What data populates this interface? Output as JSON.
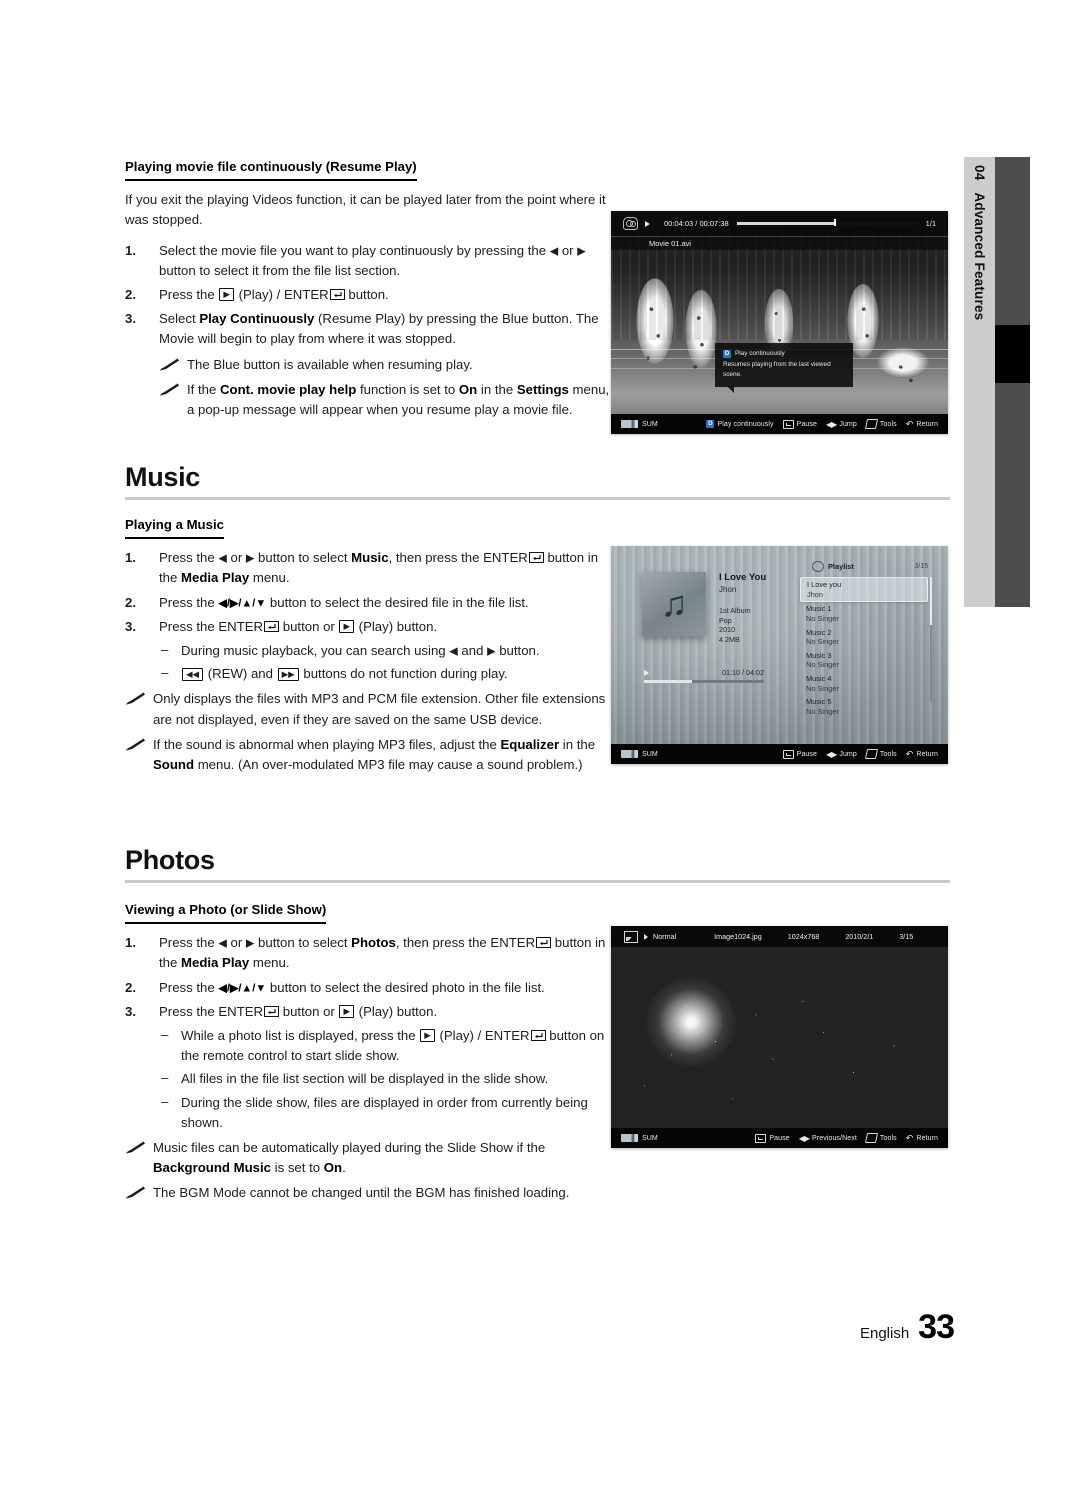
{
  "chapter_tab": {
    "number": "04",
    "label": "Advanced Features"
  },
  "footer": {
    "language": "English",
    "page": "33"
  },
  "resume_play": {
    "heading": "Playing movie file continuously (Resume Play)",
    "lead": "If you exit the playing Videos function, it can be played later from the point where it was stopped.",
    "steps": [
      {
        "num": "1.",
        "parts": [
          "Select the movie file you want to play continuously by pressing the ",
          "◀",
          " or ",
          "▶",
          " button to select it from the file list section."
        ]
      },
      {
        "num": "2.",
        "text_a": "Press the ",
        "key_play": "▶",
        "text_b": " (Play) / ",
        "text_enter": "ENTER",
        "text_c": " button."
      },
      {
        "num": "3.",
        "text_a": "Select ",
        "bold_a": "Play Continuously",
        "text_b": " (Resume Play) by pressing the Blue button. The Movie will begin to play from where it was stopped."
      }
    ],
    "notes": [
      {
        "text": "The Blue button is available when resuming play."
      },
      {
        "text_a": "If the ",
        "bold_a": "Cont. movie play help",
        "text_b": " function is set to ",
        "bold_b": "On",
        "text_c": " in the ",
        "bold_c": "Settings",
        "text_d": " menu, a pop-up message will appear when you resume play a movie file."
      }
    ]
  },
  "music_section": {
    "title": "Music",
    "subheading": "Playing a Music",
    "steps": [
      {
        "num": "1.",
        "text_a": "Press the ",
        "arrows": "◀ or ▶",
        "text_b": " button to select ",
        "bold_a": "Music",
        "text_c": ", then press the ",
        "enter": "ENTER",
        "text_d": " button in the ",
        "bold_b": "Media Play",
        "text_e": " menu."
      },
      {
        "num": "2.",
        "text_a": "Press the ",
        "arrows": "◀/▶/▲/▼",
        "text_b": " button to select the desired file in the file list."
      },
      {
        "num": "3.",
        "text_a": "Press the ",
        "enter": "ENTER",
        "text_b": " button or ",
        "key_play": "▶",
        "text_c": " (Play) button."
      }
    ],
    "dashes": [
      {
        "text_a": "During music playback, you can search using ",
        "arrow_a": "◀",
        "text_b": " and ",
        "arrow_b": "▶",
        "text_c": " button."
      },
      {
        "key_rew": "◀◀",
        "text_a": " (REW) and ",
        "key_ff": "▶▶",
        "text_b": " buttons do not function during play."
      }
    ],
    "notes": [
      {
        "text": "Only displays the files with MP3 and PCM file extension. Other file extensions are not displayed, even if they are saved on the same USB device."
      },
      {
        "text_a": "If the sound is abnormal when playing MP3 files, adjust the ",
        "bold_a": "Equalizer",
        "text_b": " in the ",
        "bold_b": "Sound",
        "text_c": " menu. (An over-modulated MP3 file may cause a sound problem.)"
      }
    ]
  },
  "photos_section": {
    "title": "Photos",
    "subheading": "Viewing a Photo (or Slide Show)",
    "steps": [
      {
        "num": "1.",
        "text_a": "Press the ",
        "arrows": "◀ or ▶",
        "text_b": " button to select ",
        "bold_a": "Photos",
        "text_c": ", then press the ",
        "enter": "ENTER",
        "text_d": " button in the ",
        "bold_b": "Media Play",
        "text_e": " menu."
      },
      {
        "num": "2.",
        "text_a": "Press the ",
        "arrows": "◀/▶/▲/▼",
        "text_b": " button to select the desired photo in the file list."
      },
      {
        "num": "3.",
        "text_a": "Press the ",
        "enter": "ENTER",
        "text_b": " button or ",
        "key_play": "▶",
        "text_c": " (Play) button."
      }
    ],
    "dashes": [
      {
        "text_a": "While a photo list is displayed, press the ",
        "key_play": "▶",
        "text_b": " (Play) / ",
        "enter": "ENTER",
        "text_c": " button on the remote control to start slide show."
      },
      {
        "text_a": "All files in the file list section will be displayed in the slide show."
      },
      {
        "text_a": "During the slide show, files are displayed in order from currently being shown."
      }
    ],
    "notes": [
      {
        "text_a": "Music files can be automatically played during the Slide Show if the ",
        "bold_a": "Background Music",
        "text_b": " is set to ",
        "bold_b": "On",
        "text_c": "."
      },
      {
        "text_a": "The BGM Mode cannot be changed until the BGM has finished loading."
      }
    ]
  },
  "movie_shot": {
    "time": "00:04:03 / 00:07:38",
    "count": "1/1",
    "filename": "Movie 01.avi",
    "popup": {
      "badge": "D",
      "title": "Play continuously",
      "body": "Resumes playing from the last viewed scene."
    },
    "bottom": {
      "device": "SUM",
      "hints": [
        {
          "badge": "D",
          "label": "Play continuously"
        },
        {
          "icon": "enter-icon",
          "label": "Pause"
        },
        {
          "icon": "left-right-icon",
          "label": "Jump"
        },
        {
          "icon": "tools-icon",
          "label": "Tools"
        },
        {
          "icon": "return-icon",
          "label": "Return"
        }
      ]
    }
  },
  "music_shot": {
    "track_title": "I Love You",
    "artist": "Jhon",
    "album": "1st Album",
    "genre": "Pop",
    "year": "2010",
    "size": "4.2MB",
    "time": "01:10 / 04:02",
    "playlist_label": "Playlist",
    "playlist_count": "3/15",
    "playlist": [
      {
        "title": "I Love you",
        "artist": "Jhon",
        "selected": true
      },
      {
        "title": "Music 1",
        "artist": "No Singer",
        "selected": false
      },
      {
        "title": "Music 2",
        "artist": "No Singer",
        "selected": false
      },
      {
        "title": "Music 3",
        "artist": "No Singer",
        "selected": false
      },
      {
        "title": "Music 4",
        "artist": "No Singer",
        "selected": false
      },
      {
        "title": "Music 5",
        "artist": "No Singer",
        "selected": false
      }
    ],
    "bottom": {
      "device": "SUM",
      "hints": [
        {
          "icon": "enter-icon",
          "label": "Pause"
        },
        {
          "icon": "left-right-icon",
          "label": "Jump"
        },
        {
          "icon": "tools-icon",
          "label": "Tools"
        },
        {
          "icon": "return-icon",
          "label": "Return"
        }
      ]
    }
  },
  "photo_shot": {
    "mode": "Normal",
    "filename": "Image1024.jpg",
    "dimensions": "1024x768",
    "date": "2010/2/1",
    "count": "3/15",
    "bottom": {
      "device": "SUM",
      "hints": [
        {
          "icon": "enter-icon",
          "label": "Pause"
        },
        {
          "icon": "left-right-icon",
          "label": "Previous/Next"
        },
        {
          "icon": "tools-icon",
          "label": "Tools"
        },
        {
          "icon": "return-icon",
          "label": "Return"
        }
      ]
    }
  }
}
